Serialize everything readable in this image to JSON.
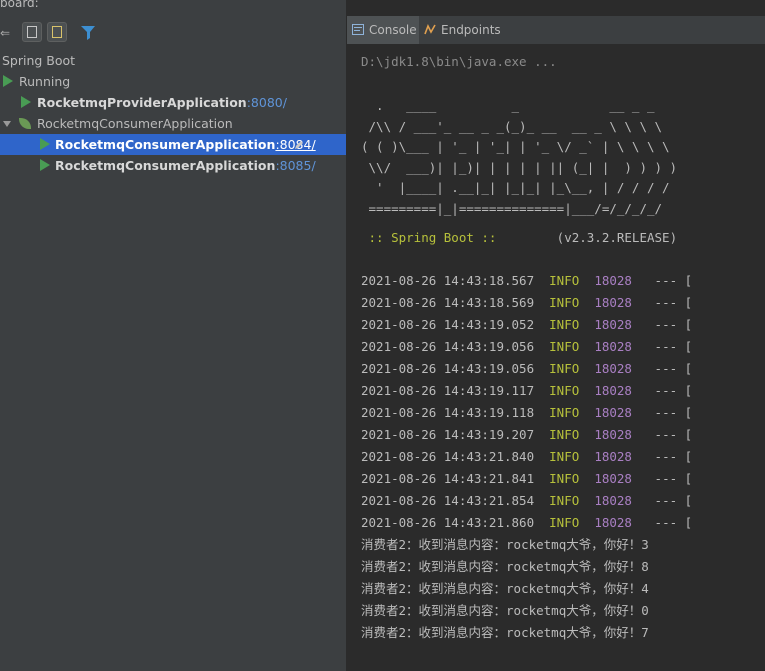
{
  "panel": {
    "title": "board:"
  },
  "tree": {
    "root": "Spring Boot",
    "running_group": "Running",
    "provider": {
      "name": "RocketmqProviderApplication",
      "port": ":8080/"
    },
    "consumer_group": "RocketmqConsumerApplication",
    "consumers": [
      {
        "name": "RocketmqConsumerApplication",
        "port": ":8084/",
        "selected": true
      },
      {
        "name": "RocketmqConsumerApplication",
        "port": ":8085/",
        "selected": false
      }
    ]
  },
  "tabs": [
    {
      "label": "Console",
      "active": true,
      "icon": "console-icon"
    },
    {
      "label": "Endpoints",
      "active": false,
      "icon": "endpoints-icon"
    }
  ],
  "console": {
    "command": "D:\\jdk1.8\\bin\\java.exe ...",
    "banner": [
      "  .   ____          _            __ _ _",
      " /\\\\ / ___'_ __ _ _(_)_ __  __ _ \\ \\ \\ \\",
      "( ( )\\___ | '_ | '_| | '_ \\/ _` | \\ \\ \\ \\",
      " \\\\/  ___)| |_)| | | | | || (_| |  ) ) ) )",
      "  '  |____| .__|_| |_|_| |_\\__, | / / / /",
      " =========|_|==============|___/=/_/_/_/"
    ],
    "spring_label": " :: Spring Boot :: ",
    "spring_version": "       (v2.3.2.RELEASE)",
    "logs": [
      {
        "ts": "2021-08-26 14:43:18.567",
        "level": "INFO",
        "pid": "18028",
        "rest": " --- ["
      },
      {
        "ts": "2021-08-26 14:43:18.569",
        "level": "INFO",
        "pid": "18028",
        "rest": " --- ["
      },
      {
        "ts": "2021-08-26 14:43:19.052",
        "level": "INFO",
        "pid": "18028",
        "rest": " --- ["
      },
      {
        "ts": "2021-08-26 14:43:19.056",
        "level": "INFO",
        "pid": "18028",
        "rest": " --- ["
      },
      {
        "ts": "2021-08-26 14:43:19.056",
        "level": "INFO",
        "pid": "18028",
        "rest": " --- ["
      },
      {
        "ts": "2021-08-26 14:43:19.117",
        "level": "INFO",
        "pid": "18028",
        "rest": " --- ["
      },
      {
        "ts": "2021-08-26 14:43:19.118",
        "level": "INFO",
        "pid": "18028",
        "rest": " --- ["
      },
      {
        "ts": "2021-08-26 14:43:19.207",
        "level": "INFO",
        "pid": "18028",
        "rest": " --- ["
      },
      {
        "ts": "2021-08-26 14:43:21.840",
        "level": "INFO",
        "pid": "18028",
        "rest": " --- ["
      },
      {
        "ts": "2021-08-26 14:43:21.841",
        "level": "INFO",
        "pid": "18028",
        "rest": " --- ["
      },
      {
        "ts": "2021-08-26 14:43:21.854",
        "level": "INFO",
        "pid": "18028",
        "rest": " --- ["
      },
      {
        "ts": "2021-08-26 14:43:21.860",
        "level": "INFO",
        "pid": "18028",
        "rest": " --- ["
      }
    ],
    "messages": [
      "消费者2：收到消息内容：rocketmq大爷，你好！3",
      "消费者2：收到消息内容：rocketmq大爷，你好！8",
      "消费者2：收到消息内容：rocketmq大爷，你好！4",
      "消费者2：收到消息内容：rocketmq大爷，你好！0",
      "消费者2：收到消息内容：rocketmq大爷，你好！7"
    ]
  },
  "colors": {
    "accent_selected": "#2f65ca",
    "run_green": "#499c54",
    "info": "#b7c13b",
    "pid": "#a97fc3"
  }
}
